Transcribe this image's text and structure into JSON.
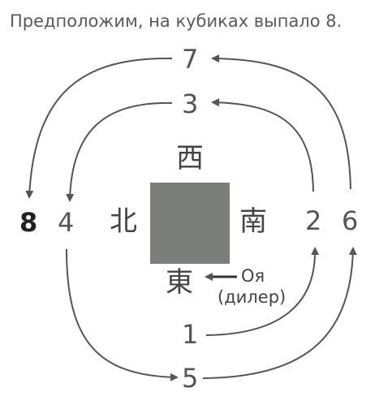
{
  "title": "Предположим, на кубиках выпало 8.",
  "numbers": {
    "n1": "1",
    "n2": "2",
    "n3": "3",
    "n4": "4",
    "n5": "5",
    "n6": "6",
    "n7": "7",
    "n8": "8"
  },
  "winds": {
    "west": "西",
    "north": "北",
    "south": "南",
    "east": "東"
  },
  "dealer": {
    "line1": "Оя",
    "line2": "(дилер)"
  },
  "colors": {
    "table": "#7b7f7b",
    "arrow": "#555555",
    "text": "#555555"
  }
}
